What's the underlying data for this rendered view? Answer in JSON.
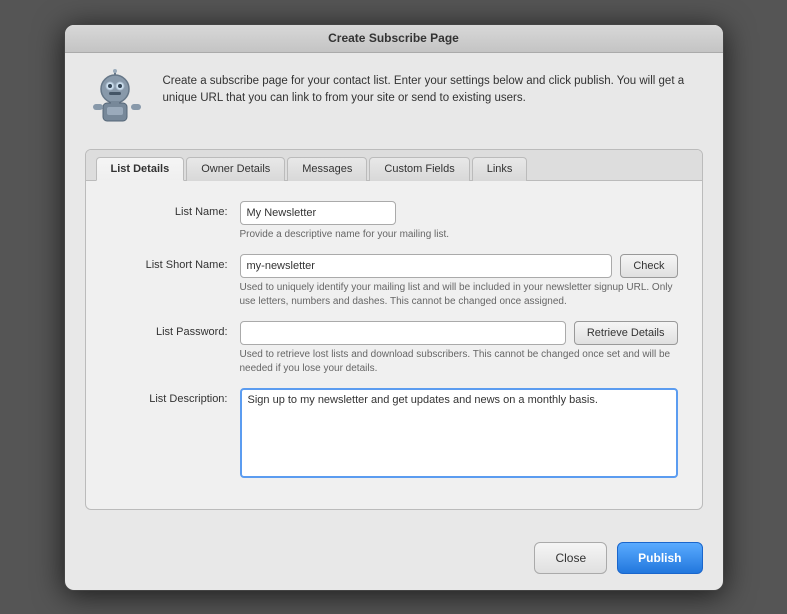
{
  "window": {
    "title": "Create Subscribe Page"
  },
  "header": {
    "description": "Create a subscribe page for your contact list. Enter your settings below and click publish. You will get a unique URL that you can link to from your site or send to existing users."
  },
  "tabs": [
    {
      "id": "list-details",
      "label": "List Details",
      "active": true
    },
    {
      "id": "owner-details",
      "label": "Owner Details",
      "active": false
    },
    {
      "id": "messages",
      "label": "Messages",
      "active": false
    },
    {
      "id": "custom-fields",
      "label": "Custom Fields",
      "active": false
    },
    {
      "id": "links",
      "label": "Links",
      "active": false
    }
  ],
  "form": {
    "list_name": {
      "label": "List Name:",
      "value": "My Newsletter",
      "hint": "Provide a descriptive name for your mailing list."
    },
    "list_short_name": {
      "label": "List Short Name:",
      "value": "my-newsletter",
      "hint": "Used to uniquely identify your mailing list and will be included in your newsletter signup URL. Only use letters, numbers and dashes. This cannot be changed once assigned.",
      "check_button": "Check"
    },
    "list_password": {
      "label": "List Password:",
      "value": "",
      "hint": "Used to retrieve lost lists and download subscribers. This cannot be changed once set and will be needed if you lose your details.",
      "retrieve_button": "Retrieve Details"
    },
    "list_description": {
      "label": "List Description:",
      "value": "Sign up to my newsletter and get updates and news on a monthly basis."
    }
  },
  "buttons": {
    "close": "Close",
    "publish": "Publish"
  }
}
